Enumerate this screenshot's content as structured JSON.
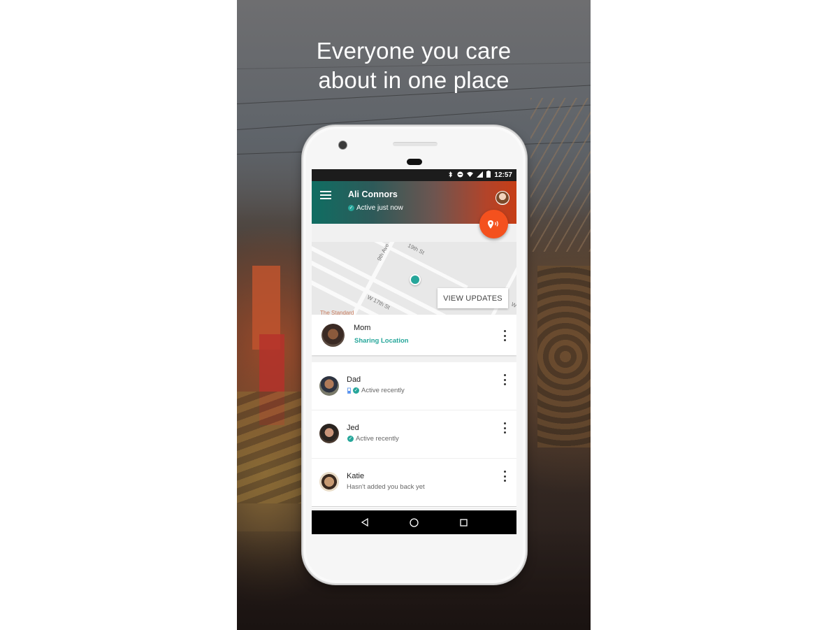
{
  "headline": {
    "line1": "Everyone you care",
    "line2": "about in one place"
  },
  "status_bar": {
    "icons": [
      "bluetooth-icon",
      "do-not-disturb-icon",
      "wifi-icon",
      "cell-signal-icon",
      "battery-icon"
    ],
    "time": "12:57"
  },
  "app_bar": {
    "menu_icon": "hamburger-menu-icon",
    "title": "Ali Connors",
    "status": "Active just now",
    "status_icon": "check-circle-icon",
    "avatar": "user-avatar",
    "fab_icon": "location-share-icon"
  },
  "map": {
    "street_labels": [
      "9th Ave",
      "19th St",
      "W 17th St",
      "W"
    ],
    "poi_label": "The Standard",
    "button_label": "VIEW UPDATES"
  },
  "featured_contact": {
    "name": "Mom",
    "status": "Sharing Location",
    "status_color": "#26a69a"
  },
  "contacts": [
    {
      "name": "Dad",
      "status": "Active recently",
      "battery_icon": true,
      "check_icon": true
    },
    {
      "name": "Jed",
      "status": "Active recently",
      "battery_icon": false,
      "check_icon": true
    },
    {
      "name": "Katie",
      "status": "Hasn't added you back yet",
      "battery_icon": false,
      "check_icon": false
    }
  ],
  "nav_bar": {
    "buttons": [
      "back-icon",
      "home-icon",
      "recents-icon"
    ]
  },
  "colors": {
    "accent_teal": "#26a69a",
    "fab_orange": "#f4511e",
    "gradient_start": "#0f6d62",
    "gradient_end": "#c63d16"
  }
}
